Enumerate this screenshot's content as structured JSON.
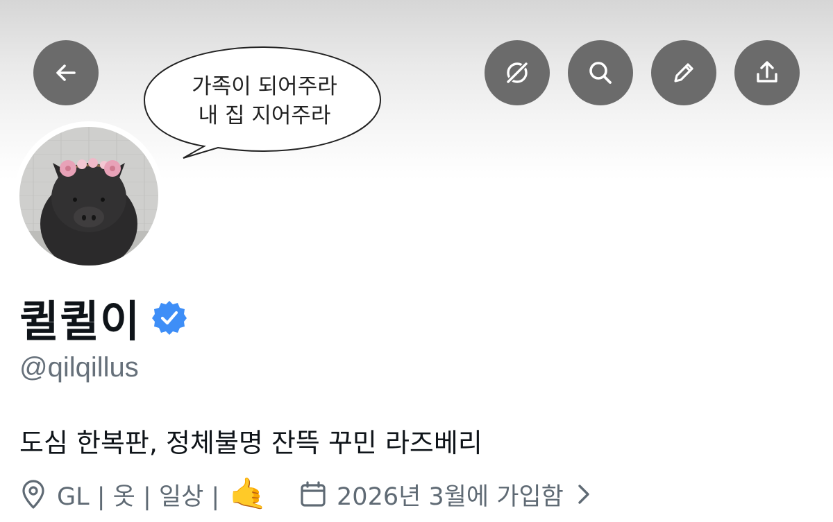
{
  "header": {
    "buttons": [
      {
        "id": "back",
        "icon": "back-arrow-icon"
      },
      {
        "id": "grok",
        "icon": "grok-icon"
      },
      {
        "id": "search",
        "icon": "search-icon"
      },
      {
        "id": "edit",
        "icon": "pencil-icon"
      },
      {
        "id": "share",
        "icon": "share-icon"
      }
    ],
    "speech_bubble": {
      "line1": "가족이 되어주라",
      "line2": "내 집 지어주라"
    }
  },
  "profile": {
    "avatar_icon": "pig-avatar",
    "display_name": "퀼퀼이",
    "verified_icon": "verified-badge-icon",
    "handle": "@qilqillus",
    "bio": "도심 한복판, 정체불명 잔뜩 꾸민 라즈베리",
    "location": "GL | 옷 | 일상 |",
    "location_emoji": "🤙",
    "joined": "2026년 3월에 가입함"
  },
  "colors": {
    "button_bg": "#6b6b6b",
    "verified_blue": "#3e8ef7",
    "secondary_text": "#5f6a74",
    "primary_text": "#0f1419"
  }
}
